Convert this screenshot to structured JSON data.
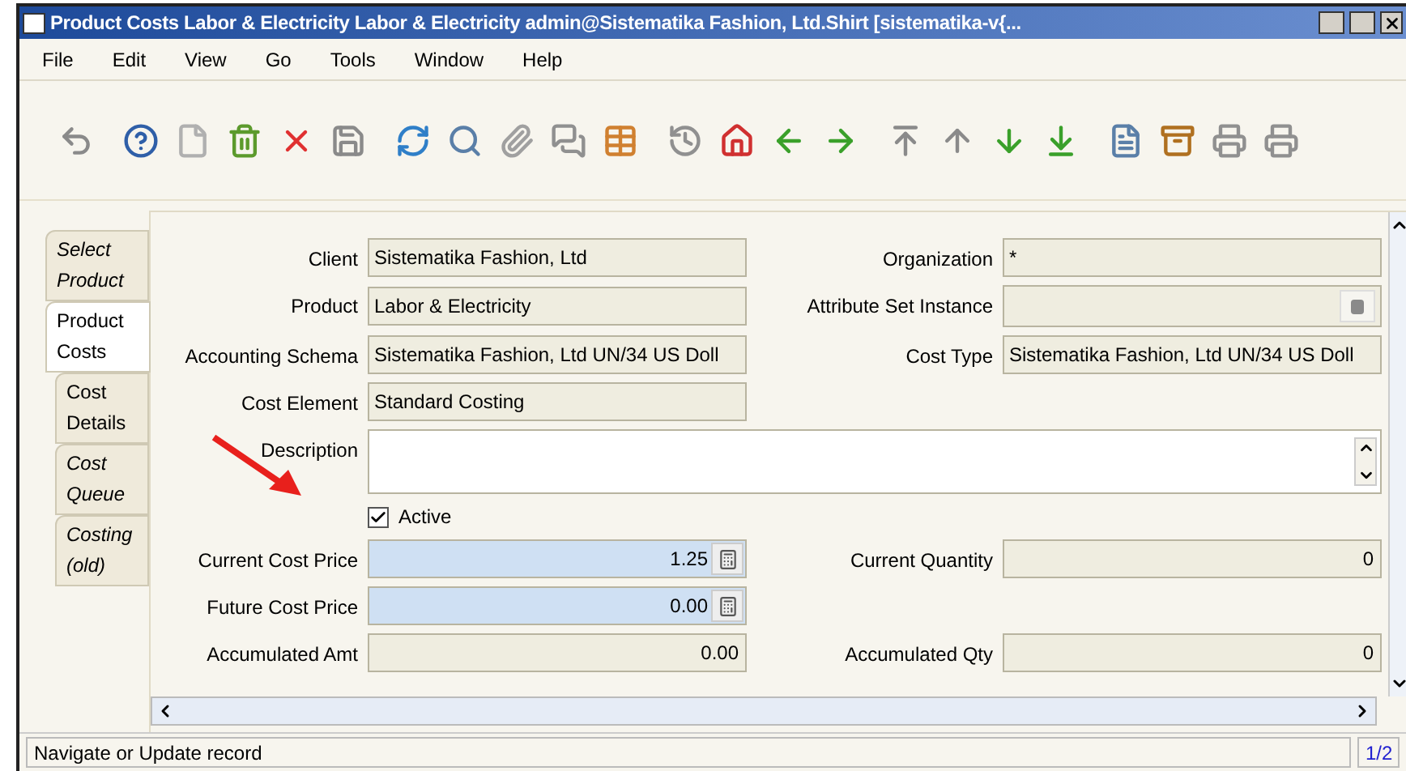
{
  "window": {
    "title": "Product Costs  Labor & Electricity  Labor & Electricity  admin@Sistematika Fashion, Ltd.Shirt [sistematika-v{..."
  },
  "menu": [
    "File",
    "Edit",
    "View",
    "Go",
    "Tools",
    "Window",
    "Help"
  ],
  "tabs": [
    {
      "label": "Select Product",
      "selected": false,
      "italic": true
    },
    {
      "label": "Product Costs",
      "selected": true,
      "italic": false
    },
    {
      "label": "Cost Details",
      "selected": false,
      "italic": false
    },
    {
      "label": "Cost Queue",
      "selected": false,
      "italic": true
    },
    {
      "label": "Costing (old)",
      "selected": false,
      "italic": true
    }
  ],
  "form": {
    "rows": [
      {
        "left": {
          "label": "Client",
          "value": "Sistematika Fashion, Ltd",
          "kind": "text",
          "editable": false
        },
        "right": {
          "label": "Organization",
          "value": "*",
          "kind": "text",
          "editable": false
        }
      },
      {
        "left": {
          "label": "Product",
          "value": "Labor & Electricity",
          "kind": "text",
          "editable": false
        },
        "right": {
          "label": "Attribute Set Instance",
          "kind": "lookup",
          "editable": false
        }
      },
      {
        "left": {
          "label": "Accounting Schema",
          "value": "Sistematika Fashion, Ltd UN/34 US Doll",
          "kind": "text",
          "editable": false
        },
        "right": {
          "label": "Cost Type",
          "value": "Sistematika Fashion, Ltd UN/34 US Doll",
          "kind": "text",
          "editable": false
        }
      },
      {
        "left": {
          "label": "Cost Element",
          "value": "Standard Costing",
          "kind": "text",
          "editable": false
        }
      },
      {
        "wide": {
          "label": "Description",
          "kind": "textarea",
          "editable": true
        }
      },
      {
        "left": {
          "label": "Active",
          "kind": "checkbox",
          "checked": true
        }
      },
      {
        "left": {
          "label": "Current Cost Price",
          "value": "1.25",
          "kind": "amount",
          "editable": true
        },
        "right": {
          "label": "Current Quantity",
          "value": "0",
          "kind": "number",
          "editable": false
        }
      },
      {
        "left": {
          "label": "Future Cost Price",
          "value": "0.00",
          "kind": "amount",
          "editable": true
        }
      },
      {
        "left": {
          "label": "Accumulated Amt",
          "value": "0.00",
          "kind": "number",
          "editable": false
        },
        "right": {
          "label": "Accumulated Qty",
          "value": "0",
          "kind": "number",
          "editable": false
        }
      }
    ]
  },
  "status_bar": {
    "message": "Navigate or Update record",
    "record": "1/2"
  }
}
